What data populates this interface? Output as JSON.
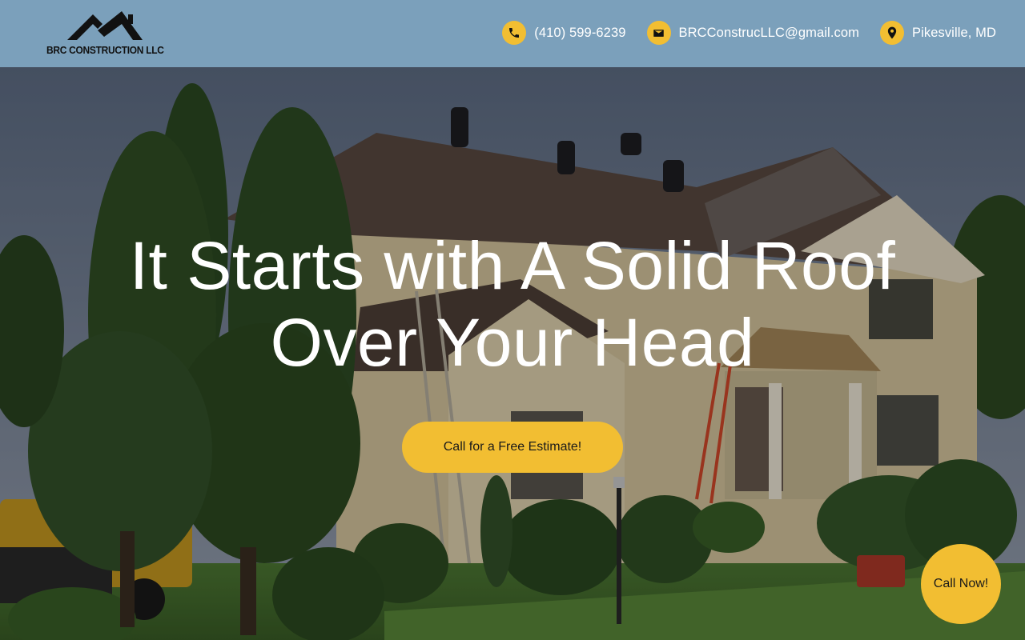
{
  "brand": {
    "name": "BRC CONSTRUCTION LLC",
    "logo_icon": "house-roof-logo"
  },
  "contacts": [
    {
      "icon": "phone-icon",
      "text": "(410) 599-6239"
    },
    {
      "icon": "mail-icon",
      "text": "BRCConstrucLLC@gmail.com"
    },
    {
      "icon": "location-pin-icon",
      "text": "Pikesville, MD"
    }
  ],
  "hero": {
    "title_line1": "It Starts with A Solid Roof",
    "title_line2": "Over Your Head",
    "cta_label": "Call for a Free Estimate!",
    "background": "roofers-working-on-house-photo"
  },
  "floating": {
    "call_now_label": "Call Now!"
  },
  "colors": {
    "header_bg": "#7ba0bb",
    "accent": "#f2be32",
    "text_light": "#ffffff"
  }
}
